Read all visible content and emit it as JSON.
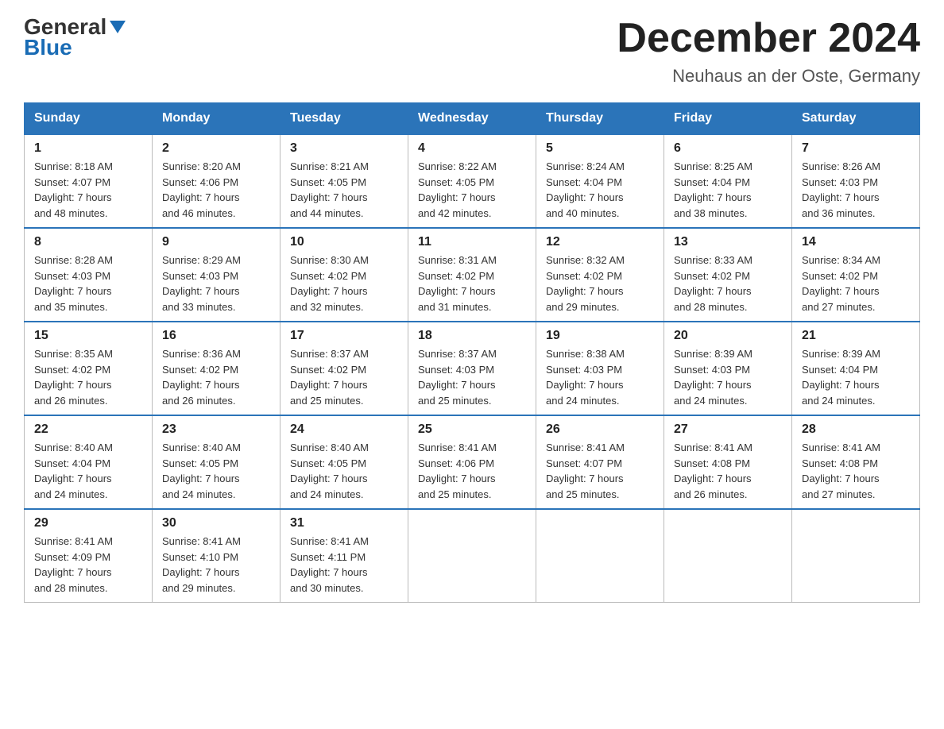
{
  "header": {
    "logo_general": "General",
    "logo_blue": "Blue",
    "month_title": "December 2024",
    "location": "Neuhaus an der Oste, Germany"
  },
  "weekdays": [
    "Sunday",
    "Monday",
    "Tuesday",
    "Wednesday",
    "Thursday",
    "Friday",
    "Saturday"
  ],
  "weeks": [
    [
      {
        "day": "1",
        "sunrise": "8:18 AM",
        "sunset": "4:07 PM",
        "daylight": "7 hours and 48 minutes."
      },
      {
        "day": "2",
        "sunrise": "8:20 AM",
        "sunset": "4:06 PM",
        "daylight": "7 hours and 46 minutes."
      },
      {
        "day": "3",
        "sunrise": "8:21 AM",
        "sunset": "4:05 PM",
        "daylight": "7 hours and 44 minutes."
      },
      {
        "day": "4",
        "sunrise": "8:22 AM",
        "sunset": "4:05 PM",
        "daylight": "7 hours and 42 minutes."
      },
      {
        "day": "5",
        "sunrise": "8:24 AM",
        "sunset": "4:04 PM",
        "daylight": "7 hours and 40 minutes."
      },
      {
        "day": "6",
        "sunrise": "8:25 AM",
        "sunset": "4:04 PM",
        "daylight": "7 hours and 38 minutes."
      },
      {
        "day": "7",
        "sunrise": "8:26 AM",
        "sunset": "4:03 PM",
        "daylight": "7 hours and 36 minutes."
      }
    ],
    [
      {
        "day": "8",
        "sunrise": "8:28 AM",
        "sunset": "4:03 PM",
        "daylight": "7 hours and 35 minutes."
      },
      {
        "day": "9",
        "sunrise": "8:29 AM",
        "sunset": "4:03 PM",
        "daylight": "7 hours and 33 minutes."
      },
      {
        "day": "10",
        "sunrise": "8:30 AM",
        "sunset": "4:02 PM",
        "daylight": "7 hours and 32 minutes."
      },
      {
        "day": "11",
        "sunrise": "8:31 AM",
        "sunset": "4:02 PM",
        "daylight": "7 hours and 31 minutes."
      },
      {
        "day": "12",
        "sunrise": "8:32 AM",
        "sunset": "4:02 PM",
        "daylight": "7 hours and 29 minutes."
      },
      {
        "day": "13",
        "sunrise": "8:33 AM",
        "sunset": "4:02 PM",
        "daylight": "7 hours and 28 minutes."
      },
      {
        "day": "14",
        "sunrise": "8:34 AM",
        "sunset": "4:02 PM",
        "daylight": "7 hours and 27 minutes."
      }
    ],
    [
      {
        "day": "15",
        "sunrise": "8:35 AM",
        "sunset": "4:02 PM",
        "daylight": "7 hours and 26 minutes."
      },
      {
        "day": "16",
        "sunrise": "8:36 AM",
        "sunset": "4:02 PM",
        "daylight": "7 hours and 26 minutes."
      },
      {
        "day": "17",
        "sunrise": "8:37 AM",
        "sunset": "4:02 PM",
        "daylight": "7 hours and 25 minutes."
      },
      {
        "day": "18",
        "sunrise": "8:37 AM",
        "sunset": "4:03 PM",
        "daylight": "7 hours and 25 minutes."
      },
      {
        "day": "19",
        "sunrise": "8:38 AM",
        "sunset": "4:03 PM",
        "daylight": "7 hours and 24 minutes."
      },
      {
        "day": "20",
        "sunrise": "8:39 AM",
        "sunset": "4:03 PM",
        "daylight": "7 hours and 24 minutes."
      },
      {
        "day": "21",
        "sunrise": "8:39 AM",
        "sunset": "4:04 PM",
        "daylight": "7 hours and 24 minutes."
      }
    ],
    [
      {
        "day": "22",
        "sunrise": "8:40 AM",
        "sunset": "4:04 PM",
        "daylight": "7 hours and 24 minutes."
      },
      {
        "day": "23",
        "sunrise": "8:40 AM",
        "sunset": "4:05 PM",
        "daylight": "7 hours and 24 minutes."
      },
      {
        "day": "24",
        "sunrise": "8:40 AM",
        "sunset": "4:05 PM",
        "daylight": "7 hours and 24 minutes."
      },
      {
        "day": "25",
        "sunrise": "8:41 AM",
        "sunset": "4:06 PM",
        "daylight": "7 hours and 25 minutes."
      },
      {
        "day": "26",
        "sunrise": "8:41 AM",
        "sunset": "4:07 PM",
        "daylight": "7 hours and 25 minutes."
      },
      {
        "day": "27",
        "sunrise": "8:41 AM",
        "sunset": "4:08 PM",
        "daylight": "7 hours and 26 minutes."
      },
      {
        "day": "28",
        "sunrise": "8:41 AM",
        "sunset": "4:08 PM",
        "daylight": "7 hours and 27 minutes."
      }
    ],
    [
      {
        "day": "29",
        "sunrise": "8:41 AM",
        "sunset": "4:09 PM",
        "daylight": "7 hours and 28 minutes."
      },
      {
        "day": "30",
        "sunrise": "8:41 AM",
        "sunset": "4:10 PM",
        "daylight": "7 hours and 29 minutes."
      },
      {
        "day": "31",
        "sunrise": "8:41 AM",
        "sunset": "4:11 PM",
        "daylight": "7 hours and 30 minutes."
      },
      null,
      null,
      null,
      null
    ]
  ],
  "labels": {
    "sunrise": "Sunrise:",
    "sunset": "Sunset:",
    "daylight": "Daylight:"
  }
}
